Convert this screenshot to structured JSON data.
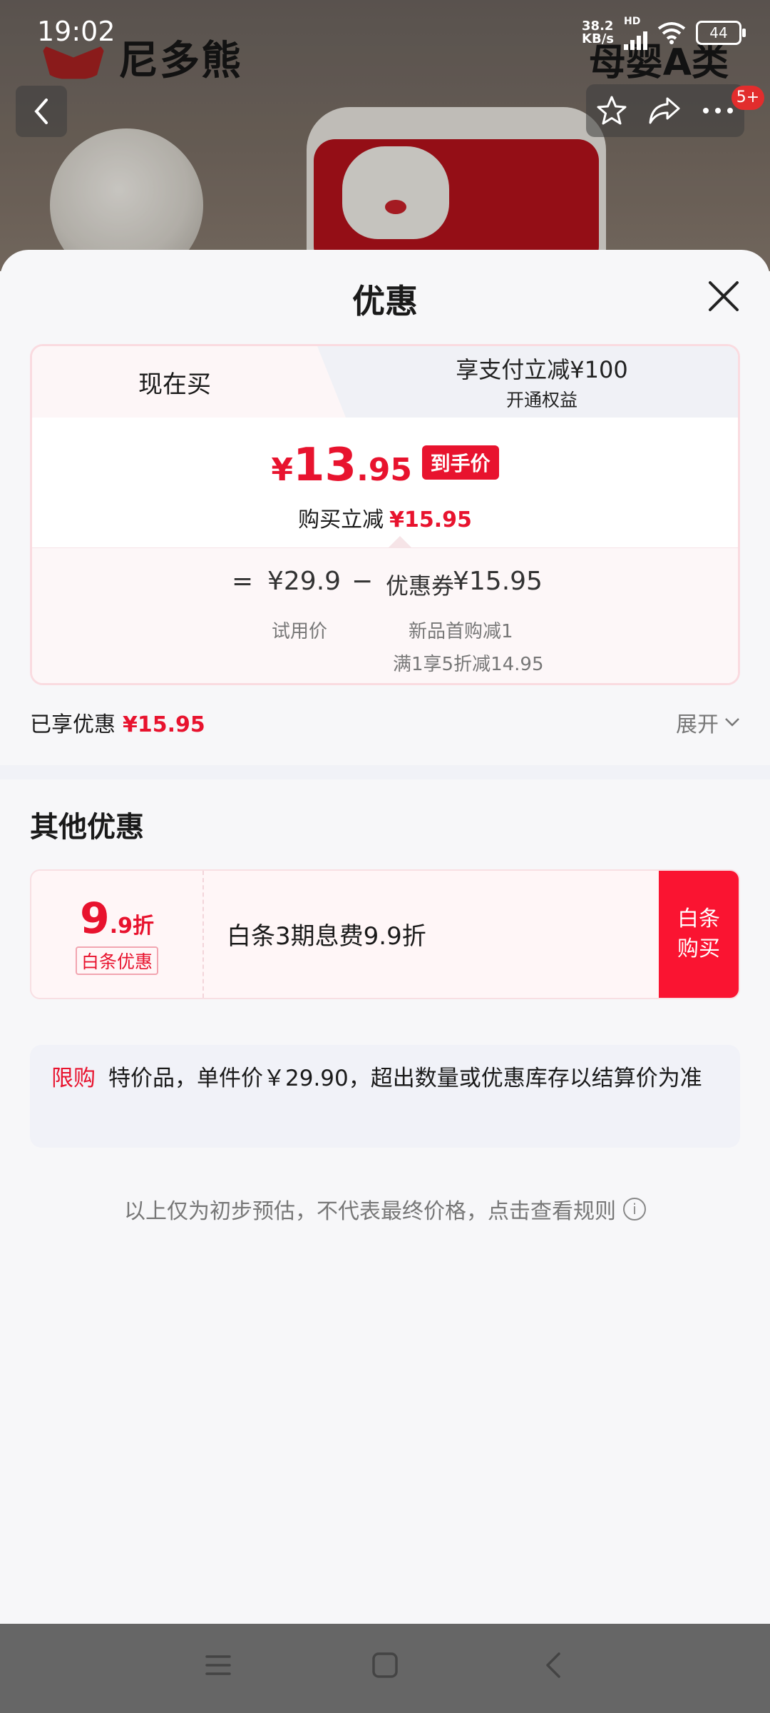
{
  "status_bar": {
    "time": "19:02",
    "net_speed_top": "38.2",
    "net_speed_bottom": "KB/s",
    "network": "HD",
    "battery": "44"
  },
  "header": {
    "brand_name": "尼多熊",
    "category": "母婴A类",
    "badge": "5+"
  },
  "sheet": {
    "title": "优惠",
    "tabs": [
      {
        "label": "现在买",
        "active": true
      },
      {
        "label": "享支付立减¥100",
        "sublabel": "开通权益",
        "active": false
      }
    ],
    "final_price": {
      "yen": "¥",
      "integer": "13",
      "decimal": ".95",
      "tag": "到手价"
    },
    "reduction": {
      "label": "购买立减",
      "value": "¥15.95"
    },
    "calc": {
      "equals": "=",
      "base_price": "¥29.9",
      "minus": "−",
      "coupon_label": "优惠券",
      "coupon_value": "¥15.95",
      "base_price_label": "试用价",
      "coupon_desc_1": "新品首购减1",
      "coupon_desc_2": "满1享5折减14.95"
    },
    "enjoyed": {
      "label": "已享优惠",
      "value": "¥15.95"
    },
    "expand_label": "展开"
  },
  "other": {
    "title": "其他优惠",
    "installment": {
      "discount_big": "9",
      "discount_small": ".9折",
      "tag": "白条优惠",
      "text": "白条3期息费9.9折",
      "button_line1": "白条",
      "button_line2": "购买"
    }
  },
  "limit": {
    "tag": "限购",
    "text": "特价品，单件价￥29.90，超出数量或优惠库存以结算价为准"
  },
  "footnote": "以上仅为初步预估，不代表最终价格，点击查看规则",
  "colors": {
    "accent_red": "#e8132e",
    "button_red": "#fa1431"
  }
}
